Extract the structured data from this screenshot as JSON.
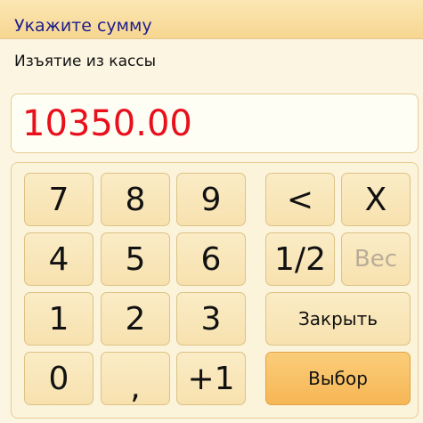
{
  "dialog": {
    "title": "Укажите сумму",
    "subtitle": "Изъятие из кассы"
  },
  "amount": {
    "value": "10350.00",
    "color": "#e8101c"
  },
  "keypad": {
    "digits": {
      "seven": "7",
      "eight": "8",
      "nine": "9",
      "four": "4",
      "five": "5",
      "six": "6",
      "one": "1",
      "two": "2",
      "three": "3",
      "zero": "0",
      "comma": ",",
      "plus_one": "+1"
    },
    "actions": {
      "backspace": "<",
      "clear": "X",
      "half": "1/2",
      "weight": "Вес",
      "close": "Закрыть",
      "select": "Выбор"
    },
    "weight_enabled": false
  }
}
